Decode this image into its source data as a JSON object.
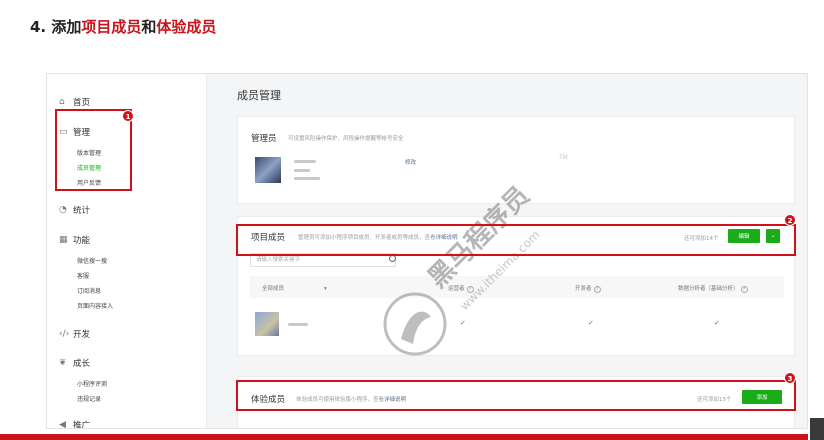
{
  "heading": {
    "prefix": "4. 添加",
    "term1": "项目成员",
    "connector": "和",
    "term2": "体验成员"
  },
  "sidebar": {
    "home": "首页",
    "manage": "管理",
    "manage_items": [
      "版本管理",
      "成员管理",
      "用户反馈"
    ],
    "stats": "统计",
    "features": "功能",
    "feature_items": [
      "微信搜一搜",
      "客服",
      "订阅消息",
      "页面内容接入"
    ],
    "dev": "开发",
    "growth": "成长",
    "growth_items": [
      "小程序评测",
      "违规记录"
    ],
    "promote": "推广"
  },
  "page_title": "成员管理",
  "admin_card": {
    "title": "管理员",
    "desc": "可设置风险操作保护、风险操作提醒等帐号安全",
    "edit": "修改"
  },
  "project_card": {
    "title": "项目成员",
    "desc": "管理员可添加小程序项目成员、开发者成员等成员，查看",
    "desc_link": "详细说明",
    "available": "还可添加14个",
    "edit_button": "编辑",
    "dropdown_icon": "chevron-down",
    "search_placeholder": "请输入搜索关键字",
    "columns": [
      "全部成员",
      "运营者",
      "开发者",
      "数据分析者（基础分析）"
    ]
  },
  "trial_card": {
    "title": "体验成员",
    "desc": "体验成员可使用体验版小程序，查看",
    "desc_link": "详细说明",
    "available": "还可添加15个",
    "add_button": "添加"
  },
  "badges": [
    "1",
    "2",
    "3"
  ],
  "watermark": {
    "brand": "黑马程序员",
    "site": "www.itheima.com",
    "tm": "TM"
  },
  "colors": {
    "accent_green": "#1aad19",
    "highlight_red": "#d0111b",
    "heading_red": "#c8141c"
  }
}
